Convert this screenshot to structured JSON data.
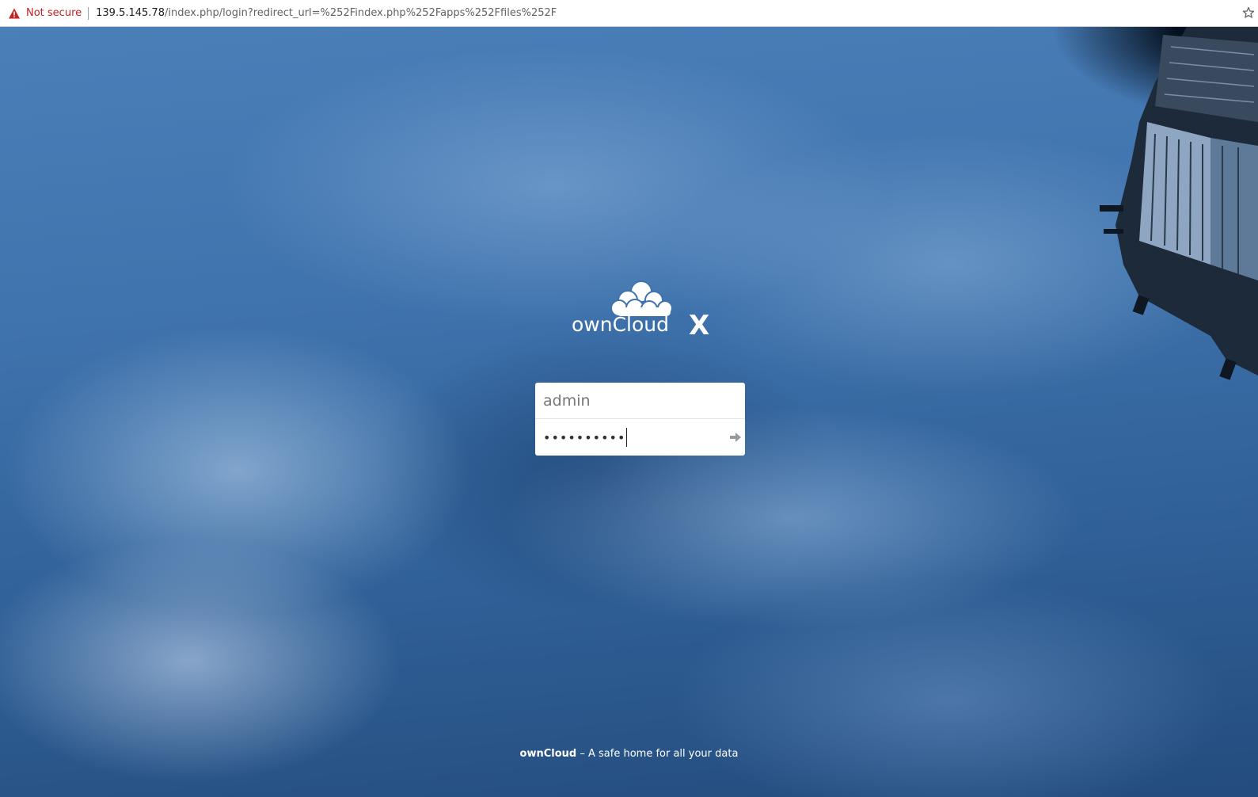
{
  "browser": {
    "security_label": "Not secure",
    "url_host": "139.5.145.78",
    "url_path": "/index.php/login?redirect_url=%252Findex.php%252Fapps%252Ffiles%252F",
    "icons": {
      "warning": "warning-triangle-icon",
      "bookmark": "star-icon"
    },
    "colors": {
      "warning": "#c5221f"
    }
  },
  "logo": {
    "text": "ownCloud X",
    "icon": "cloud-logo-icon"
  },
  "login": {
    "username_value": "admin",
    "password_mask": "••••••••••",
    "submit_icon": "arrow-right-icon"
  },
  "footer": {
    "brand": "ownCloud",
    "tagline": " – A safe home for all your data"
  },
  "theme": {
    "background": "#3f73ad"
  }
}
